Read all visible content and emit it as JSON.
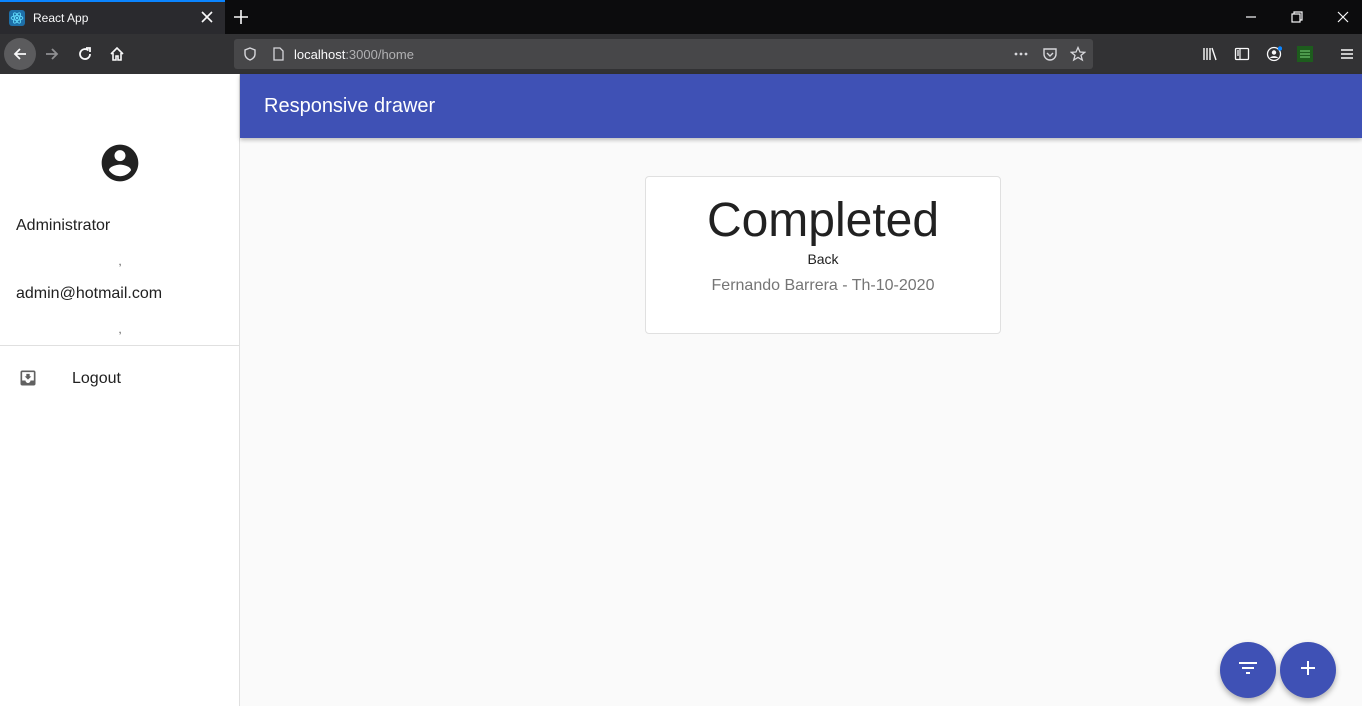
{
  "browser": {
    "tab_title": "React App",
    "url_host": "localhost",
    "url_rest": ":3000/home"
  },
  "drawer": {
    "user_name": "Administrator",
    "separator": ",",
    "user_email": "admin@hotmail.com",
    "logout_label": "Logout"
  },
  "appbar": {
    "title": "Responsive drawer"
  },
  "card": {
    "title": "Completed",
    "back_label": "Back",
    "subtitle": "Fernando Barrera - Th-10-2020"
  },
  "colors": {
    "primary": "#3f51b5",
    "browser_accent": "#0a84ff"
  }
}
